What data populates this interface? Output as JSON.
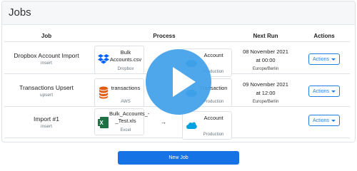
{
  "card": {
    "title": "Jobs"
  },
  "columns": {
    "job": "Job",
    "process": "Process",
    "next_run": "Next Run",
    "actions": "Actions"
  },
  "jobs": [
    {
      "name": "Dropbox Account Import",
      "type": "insert",
      "source": {
        "title": "Bulk Accounts.csv",
        "subtitle": "Dropbox",
        "icon": "dropbox-icon"
      },
      "target": {
        "title": "Account",
        "subtitle": "Production",
        "icon": "salesforce-icon"
      },
      "next_run": {
        "date": "08 November 2021",
        "time": "at 00:00",
        "tz": "Europe/Berlin"
      },
      "action_label": "Actions"
    },
    {
      "name": "Transactions Upsert",
      "type": "upsert",
      "source": {
        "title": "transactions",
        "subtitle": "AWS",
        "icon": "database-icon"
      },
      "target": {
        "title": "Transaction",
        "subtitle": "Production",
        "icon": "salesforce-icon"
      },
      "next_run": {
        "date": "09 November 2021",
        "time": "at 12:00",
        "tz": "Europe/Berlin"
      },
      "action_label": "Actions"
    },
    {
      "name": "Import #1",
      "type": "insert",
      "source": {
        "title": "Bulk_Accounts_-_Test.xls",
        "subtitle": "Excel",
        "icon": "excel-icon"
      },
      "target": {
        "title": "Account",
        "subtitle": "Production",
        "icon": "salesforce-icon"
      },
      "arrow": "→",
      "action_label": "Actions"
    }
  ],
  "new_job_label": "New Job",
  "overlay": {
    "icon": "play-icon",
    "color": "#42a0ea"
  },
  "colors": {
    "primary": "#1673e6",
    "header_bg": "#f6f7f9"
  }
}
